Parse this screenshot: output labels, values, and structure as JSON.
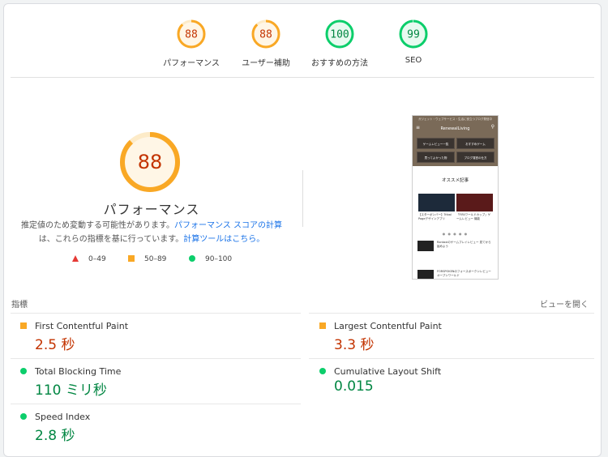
{
  "summary": [
    {
      "score": "88",
      "label": "パフォーマンス",
      "color": "#f9a825",
      "text_color": "#c33300",
      "fraction": 0.88
    },
    {
      "score": "88",
      "label": "ユーザー補助",
      "color": "#f9a825",
      "text_color": "#c33300",
      "fraction": 0.88
    },
    {
      "score": "100",
      "label": "おすすめの方法",
      "color": "#0cce6b",
      "text_color": "#018642",
      "fraction": 1.0
    },
    {
      "score": "99",
      "label": "SEO",
      "color": "#0cce6b",
      "text_color": "#018642",
      "fraction": 0.99
    }
  ],
  "main": {
    "score": "88",
    "score_fraction": 0.88,
    "title": "パフォーマンス",
    "desc_1": "推定値のため変動する可能性があります。",
    "desc_link_1": "パフォーマンス スコアの計算",
    "desc_2": "は、これらの指標を基に行っています。",
    "desc_link_2": "計算ツールはこちら。"
  },
  "legend": {
    "fail": "0–49",
    "average": "50–89",
    "pass": "90–100"
  },
  "screenshot": {
    "top_text": "ガジェット・ウェブサービス・生活に役立つブログ発信中",
    "brand": "RenewalLiving",
    "buttons": [
      "ゲームレビュー一覧",
      "おすすめゲーム",
      "買ってよかった物",
      "ブログ運営の仕方"
    ],
    "section_title": "オススメ記事",
    "card_captions": [
      "【スターボンバー】Tribal Pageデザインアプリ",
      "「FIFAワールドカップ」ゲームレビュー 機能"
    ],
    "rows": [
      "Rantaxiのゲームプレイレビュー 見てから始めよう",
      "FORSPOKENのフォースポークンレビュー オープンワールド"
    ]
  },
  "metrics": {
    "heading": "指標",
    "expand": "ビューを開く",
    "items": [
      {
        "name": "First Contentful Paint",
        "value": "2.5 秒",
        "status": "average"
      },
      {
        "name": "Largest Contentful Paint",
        "value": "3.3 秒",
        "status": "average"
      },
      {
        "name": "Total Blocking Time",
        "value": "110 ミリ秒",
        "status": "pass"
      },
      {
        "name": "Cumulative Layout Shift",
        "value": "0.015",
        "status": "pass"
      },
      {
        "name": "Speed Index",
        "value": "2.8 秒",
        "status": "pass"
      }
    ]
  }
}
